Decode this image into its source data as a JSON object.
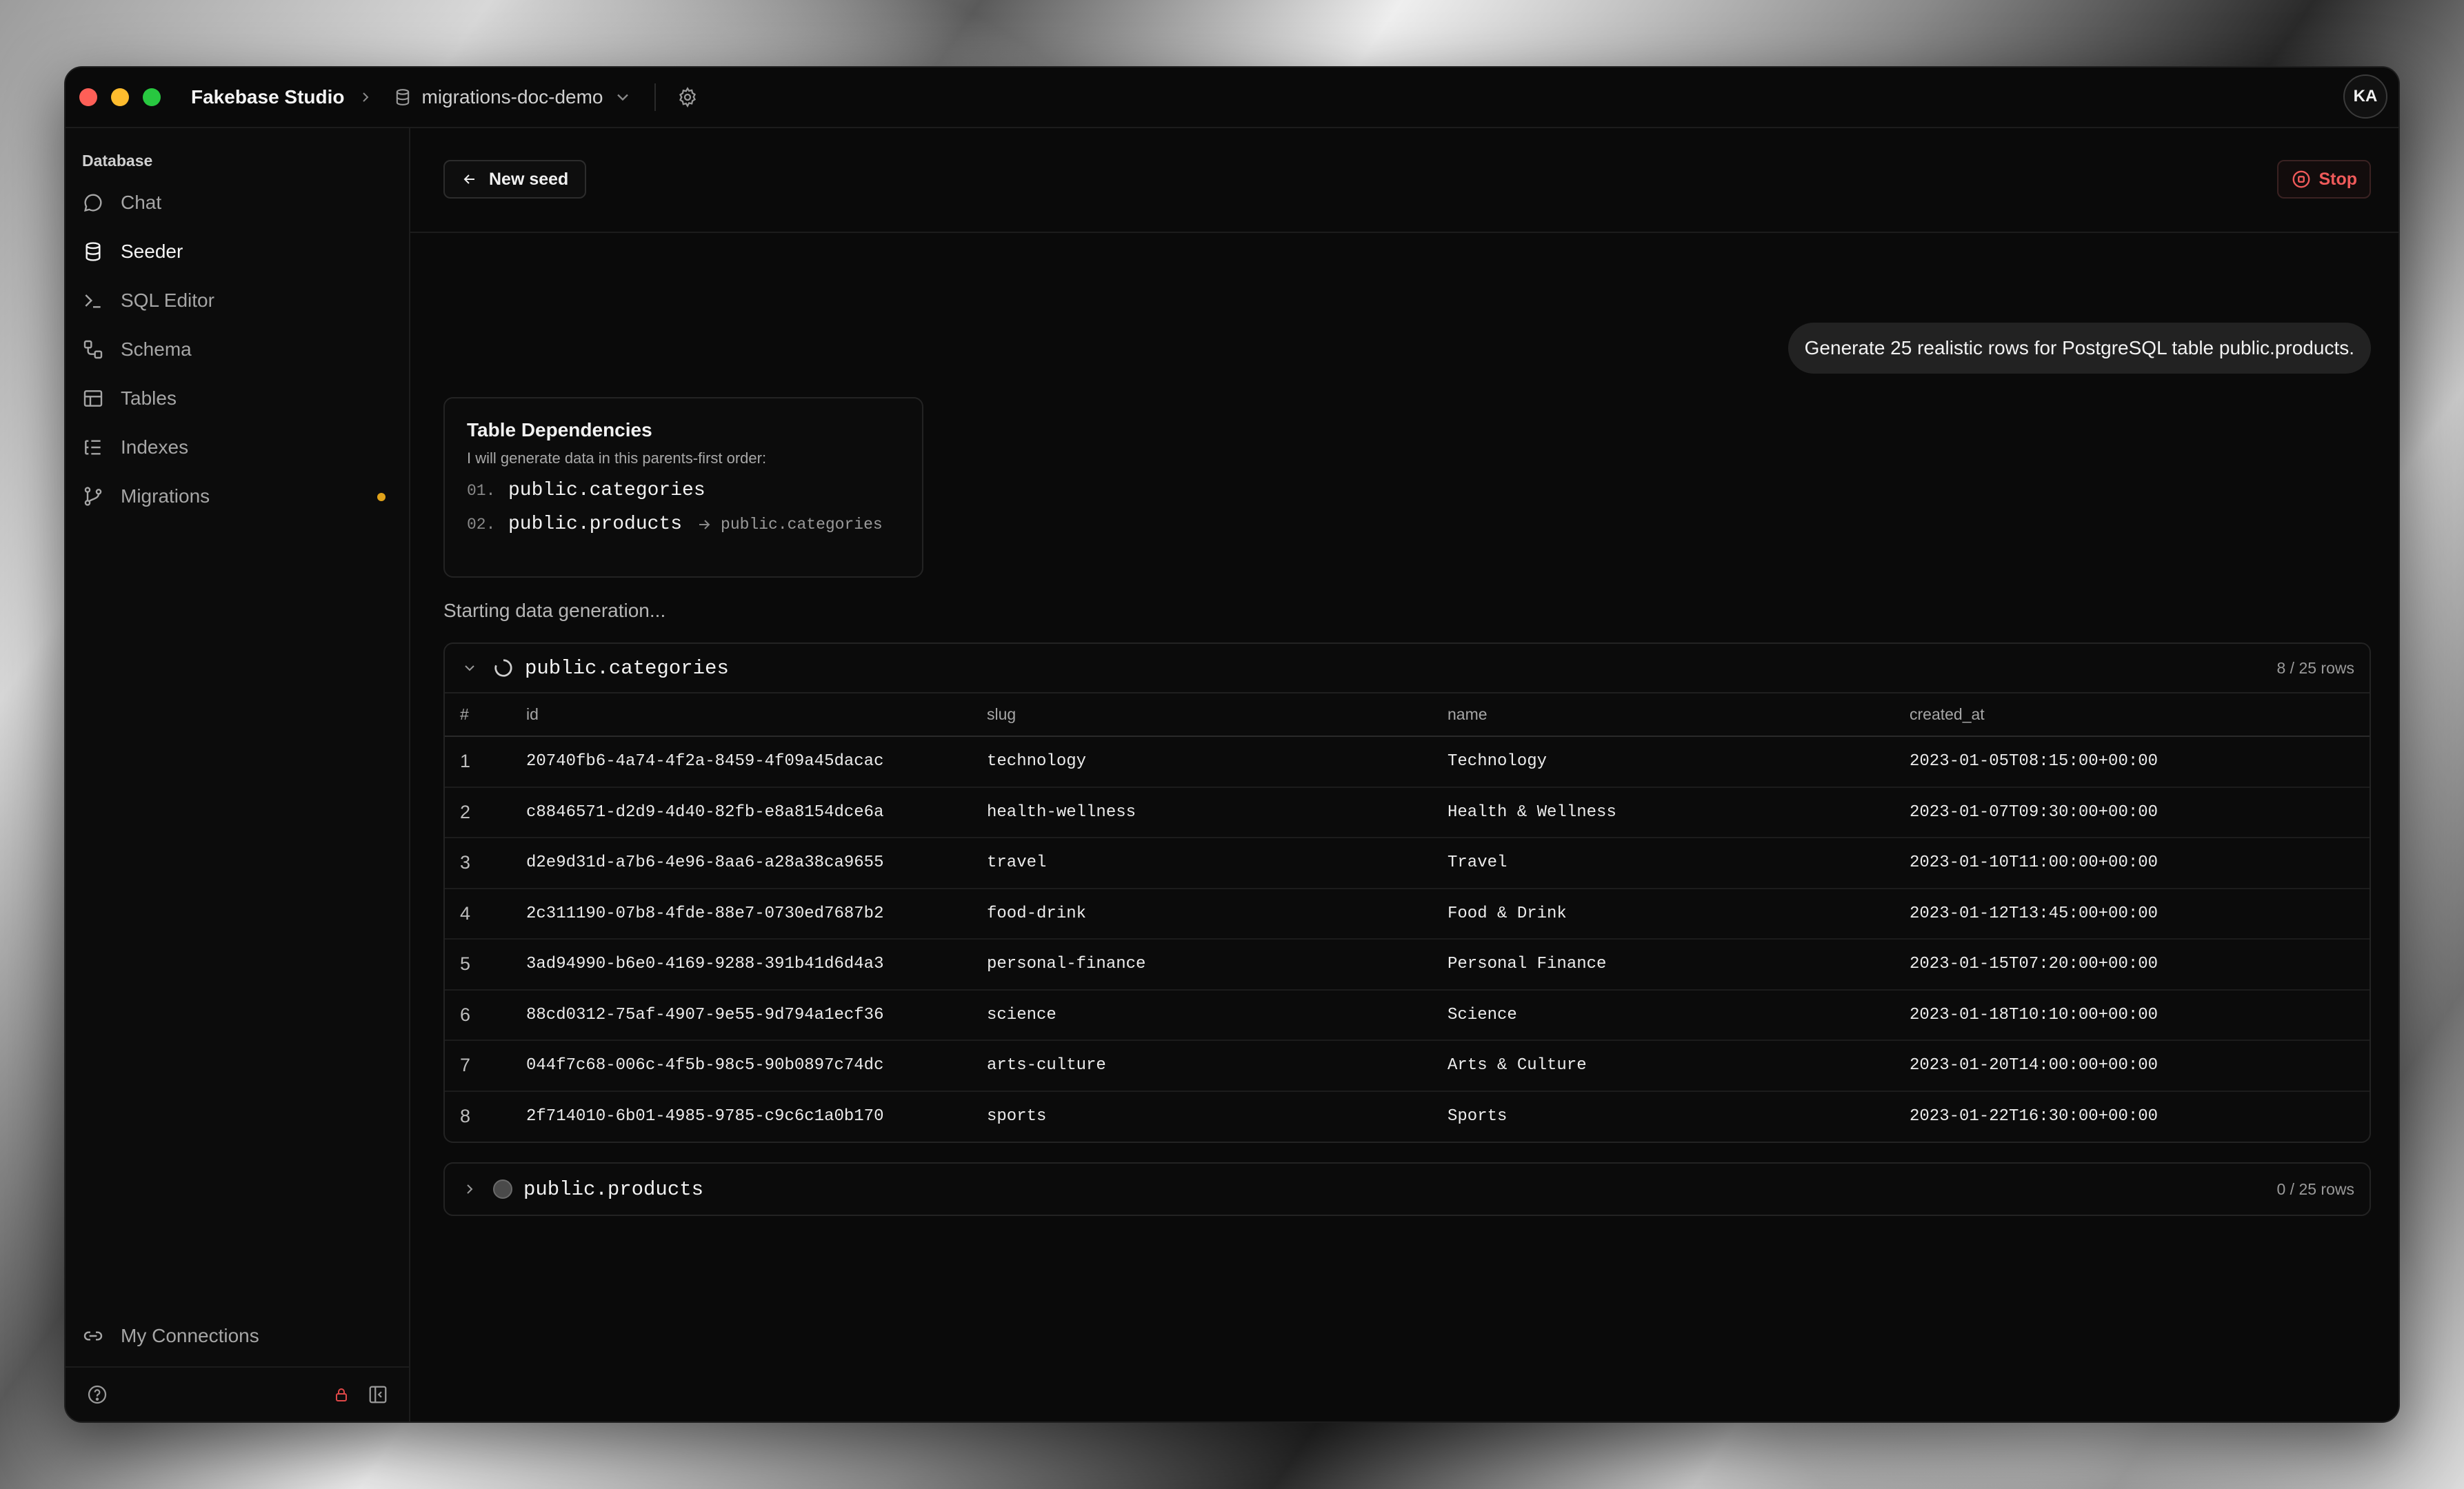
{
  "titlebar": {
    "app_name": "Fakebase Studio",
    "project": "migrations-doc-demo",
    "avatar_initials": "KA"
  },
  "sidebar": {
    "section_title": "Database",
    "items": [
      {
        "label": "Chat",
        "icon": "chat-icon"
      },
      {
        "label": "Seeder",
        "icon": "database-icon",
        "active": true
      },
      {
        "label": "SQL Editor",
        "icon": "terminal-icon"
      },
      {
        "label": "Schema",
        "icon": "schema-icon"
      },
      {
        "label": "Tables",
        "icon": "table-icon"
      },
      {
        "label": "Indexes",
        "icon": "list-icon"
      },
      {
        "label": "Migrations",
        "icon": "branch-icon",
        "badge_color": "#e0a21a"
      }
    ],
    "connections_label": "My Connections"
  },
  "toolbar": {
    "new_seed_label": "New seed",
    "stop_label": "Stop"
  },
  "chat": {
    "prompt": "Generate 25 realistic rows for PostgreSQL table public.products.",
    "dependencies": {
      "title": "Table Dependencies",
      "subtitle": "I will generate data in this parents-first order:",
      "items": [
        {
          "num": "01.",
          "table": "public.categories",
          "ref": ""
        },
        {
          "num": "02.",
          "table": "public.products",
          "ref": "public.categories"
        }
      ]
    },
    "status": "Starting data generation..."
  },
  "tables": [
    {
      "name": "public.categories",
      "progress": "8 / 25 rows",
      "state": "generating",
      "columns": [
        "#",
        "id",
        "slug",
        "name",
        "created_at"
      ],
      "rows": [
        [
          "1",
          "20740fb6-4a74-4f2a-8459-4f09a45dacac",
          "technology",
          "Technology",
          "2023-01-05T08:15:00+00:00"
        ],
        [
          "2",
          "c8846571-d2d9-4d40-82fb-e8a8154dce6a",
          "health-wellness",
          "Health & Wellness",
          "2023-01-07T09:30:00+00:00"
        ],
        [
          "3",
          "d2e9d31d-a7b6-4e96-8aa6-a28a38ca9655",
          "travel",
          "Travel",
          "2023-01-10T11:00:00+00:00"
        ],
        [
          "4",
          "2c311190-07b8-4fde-88e7-0730ed7687b2",
          "food-drink",
          "Food & Drink",
          "2023-01-12T13:45:00+00:00"
        ],
        [
          "5",
          "3ad94990-b6e0-4169-9288-391b41d6d4a3",
          "personal-finance",
          "Personal Finance",
          "2023-01-15T07:20:00+00:00"
        ],
        [
          "6",
          "88cd0312-75af-4907-9e55-9d794a1ecf36",
          "science",
          "Science",
          "2023-01-18T10:10:00+00:00"
        ],
        [
          "7",
          "044f7c68-006c-4f5b-98c5-90b0897c74dc",
          "arts-culture",
          "Arts & Culture",
          "2023-01-20T14:00:00+00:00"
        ],
        [
          "8",
          "2f714010-6b01-4985-9785-c9c6c1a0b170",
          "sports",
          "Sports",
          "2023-01-22T16:30:00+00:00"
        ]
      ]
    },
    {
      "name": "public.products",
      "progress": "0 / 25 rows",
      "state": "pending"
    }
  ]
}
